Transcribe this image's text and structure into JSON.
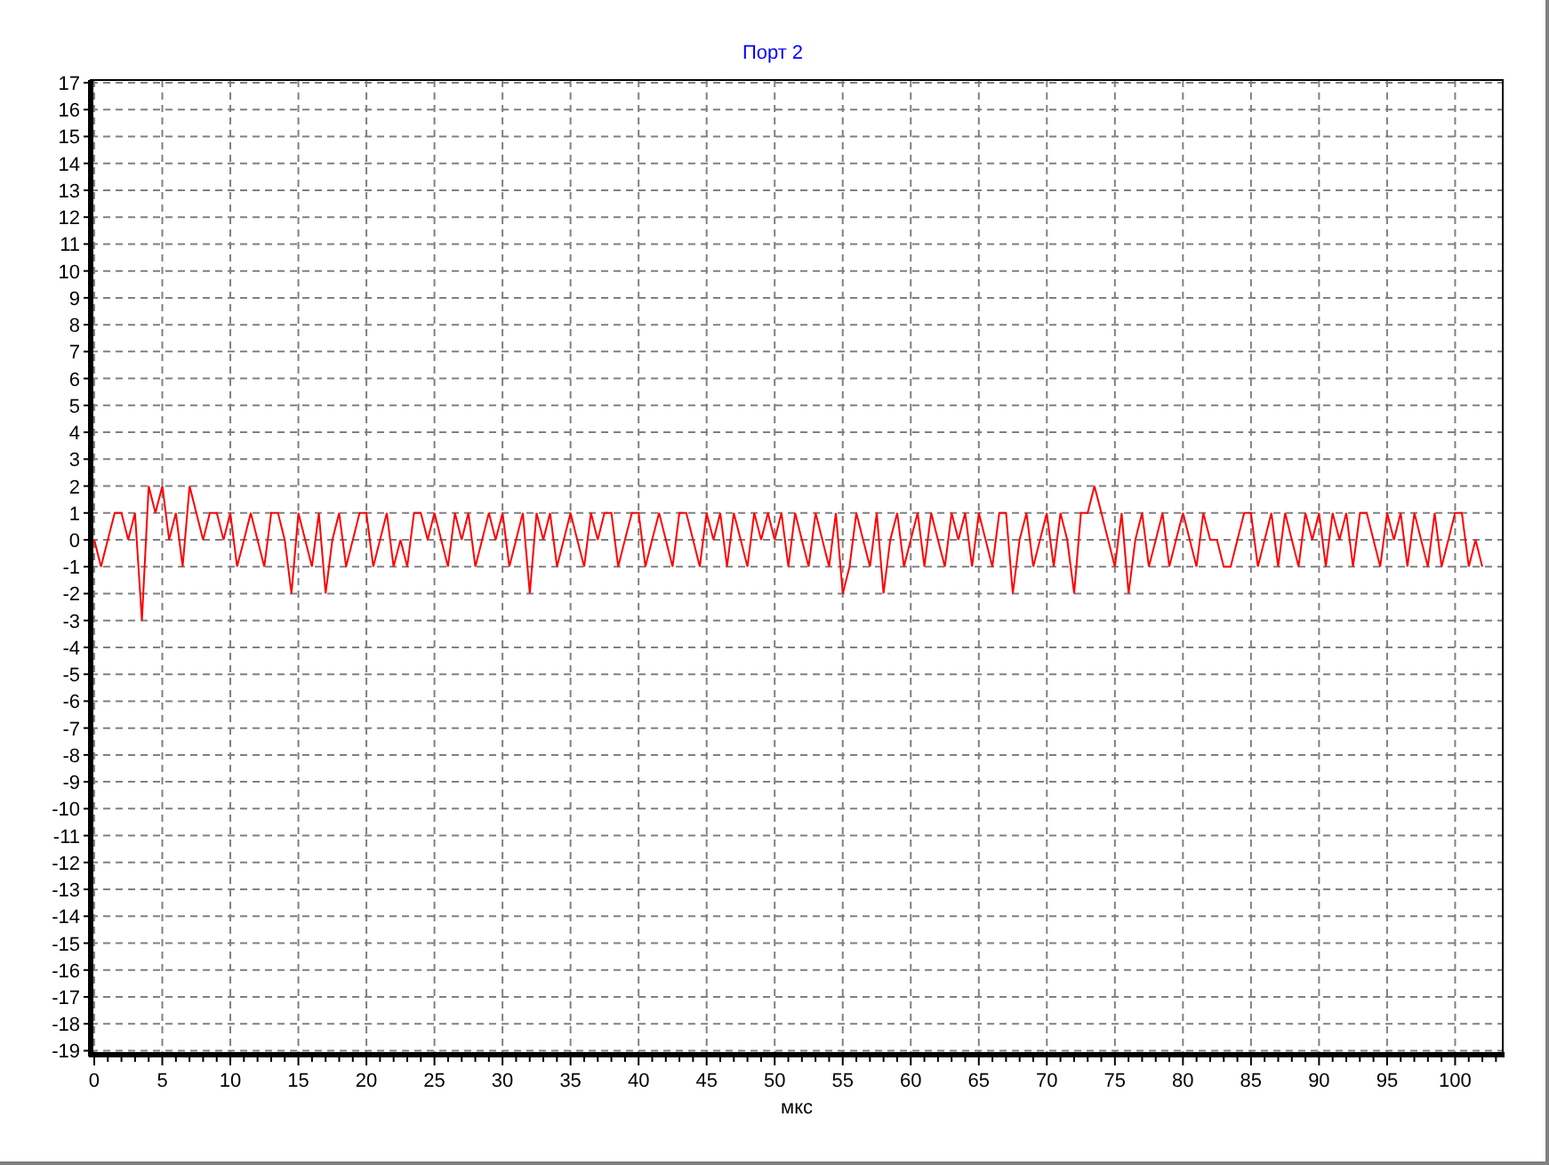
{
  "chart_data": {
    "type": "line",
    "title": "Порт 2",
    "xlabel": "мкс",
    "xlim": [
      -0.26,
      103.5
    ],
    "ylim": [
      -19.15,
      17.1
    ],
    "grid": true,
    "xticks": [
      0,
      5,
      10,
      15,
      20,
      25,
      30,
      35,
      40,
      45,
      50,
      55,
      60,
      65,
      70,
      75,
      80,
      85,
      90,
      95,
      100
    ],
    "yticks": [
      17,
      16,
      15,
      14,
      13,
      12,
      11,
      10,
      9,
      8,
      7,
      6,
      5,
      4,
      3,
      2,
      1,
      0,
      -1,
      -2,
      -3,
      -4,
      -5,
      -6,
      -7,
      -8,
      -9,
      -10,
      -11,
      -12,
      -13,
      -14,
      -15,
      -16,
      -17,
      -18,
      -19
    ],
    "x": [
      0,
      0.5,
      1,
      1.5,
      2,
      2.5,
      3,
      3.5,
      4,
      4.5,
      5,
      5.5,
      6,
      6.5,
      7,
      7.5,
      8,
      8.5,
      9,
      9.5,
      10,
      10.5,
      11,
      11.5,
      12,
      12.5,
      13,
      13.5,
      14,
      14.5,
      15,
      15.5,
      16,
      16.5,
      17,
      17.5,
      18,
      18.5,
      19,
      19.5,
      20,
      20.5,
      21,
      21.5,
      22,
      22.5,
      23,
      23.5,
      24,
      24.5,
      25,
      25.5,
      26,
      26.5,
      27,
      27.5,
      28,
      28.5,
      29,
      29.5,
      30,
      30.5,
      31,
      31.5,
      32,
      32.5,
      33,
      33.5,
      34,
      34.5,
      35,
      35.5,
      36,
      36.5,
      37,
      37.5,
      38,
      38.5,
      39,
      39.5,
      40,
      40.5,
      41,
      41.5,
      42,
      42.5,
      43,
      43.5,
      44,
      44.5,
      45,
      45.5,
      46,
      46.5,
      47,
      47.5,
      48,
      48.5,
      49,
      49.5,
      50,
      50.5,
      51,
      51.5,
      52,
      52.5,
      53,
      53.5,
      54,
      54.5,
      55,
      55.5,
      56,
      56.5,
      57,
      57.5,
      58,
      58.5,
      59,
      59.5,
      60,
      60.5,
      61,
      61.5,
      62,
      62.5,
      63,
      63.5,
      64,
      64.5,
      65,
      65.5,
      66,
      66.5,
      67,
      67.5,
      68,
      68.5,
      69,
      69.5,
      70,
      70.5,
      71,
      71.5,
      72,
      72.5,
      73,
      73.5,
      74,
      74.5,
      75,
      75.5,
      76,
      76.5,
      77,
      77.5,
      78,
      78.5,
      79,
      79.5,
      80,
      80.5,
      81,
      81.5,
      82,
      82.5,
      83,
      83.5,
      84,
      84.5,
      85,
      85.5,
      86,
      86.5,
      87,
      87.5,
      88,
      88.5,
      89,
      89.5,
      90,
      90.5,
      91,
      91.5,
      92,
      92.5,
      93,
      93.5,
      94,
      94.5,
      95,
      95.5,
      96,
      96.5,
      97,
      97.5,
      98,
      98.5,
      99,
      99.5,
      100,
      100.5,
      101,
      101.5,
      102
    ],
    "series": [
      {
        "color": "#ff0000",
        "values": [
          0,
          -1,
          0,
          1,
          1,
          0,
          1,
          -3,
          2,
          1,
          2,
          0,
          1,
          -1,
          2,
          1,
          0,
          1,
          1,
          0,
          1,
          -1,
          0,
          1,
          0,
          -1,
          1,
          1,
          0,
          -2,
          1,
          0,
          -1,
          1,
          -2,
          0,
          1,
          -1,
          0,
          1,
          1,
          -1,
          0,
          1,
          -1,
          0,
          -1,
          1,
          1,
          0,
          1,
          0,
          -1,
          1,
          0,
          1,
          -1,
          0,
          1,
          0,
          1,
          -1,
          0,
          1,
          -2,
          1,
          0,
          1,
          -1,
          0,
          1,
          0,
          -1,
          1,
          0,
          1,
          1,
          -1,
          0,
          1,
          1,
          -1,
          0,
          1,
          0,
          -1,
          1,
          1,
          0,
          -1,
          1,
          0,
          1,
          -1,
          1,
          0,
          -1,
          1,
          0,
          1,
          0,
          1,
          -1,
          1,
          0,
          -1,
          1,
          0,
          -1,
          1,
          -2,
          -1,
          1,
          0,
          -1,
          1,
          -2,
          0,
          1,
          -1,
          0,
          1,
          -1,
          1,
          0,
          -1,
          1,
          0,
          1,
          -1,
          1,
          0,
          -1,
          1,
          1,
          -2,
          0,
          1,
          -1,
          0,
          1,
          -1,
          1,
          0,
          -2,
          1,
          1,
          2,
          1,
          0,
          -1,
          1,
          -2,
          0,
          1,
          -1,
          0,
          1,
          -1,
          0,
          1,
          0,
          -1,
          1,
          0,
          0,
          -1,
          -1,
          0,
          1,
          1,
          -1,
          0,
          1,
          -1,
          1,
          0,
          -1,
          1,
          0,
          1,
          -1,
          1,
          0,
          1,
          -1,
          1,
          1,
          0,
          -1,
          1,
          0,
          1,
          -1,
          1,
          0,
          -1,
          1,
          -1,
          0,
          1,
          1,
          -1,
          0,
          -1
        ]
      }
    ]
  }
}
